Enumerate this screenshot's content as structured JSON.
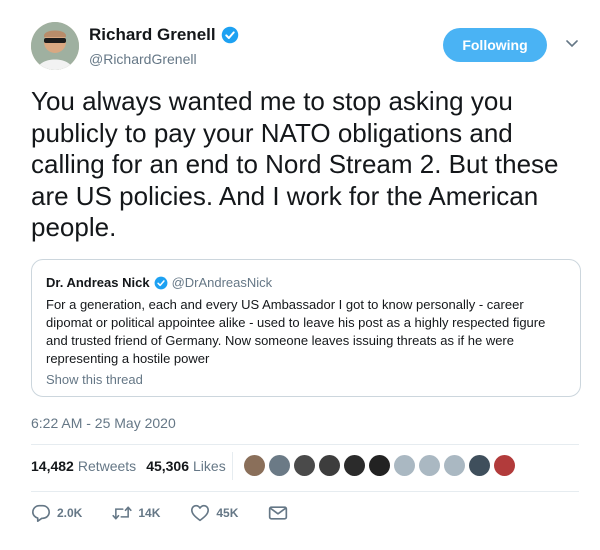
{
  "author": {
    "display_name": "Richard Grenell",
    "handle": "@RichardGrenell",
    "verified": true,
    "avatar_icon": "avatar"
  },
  "follow_button": {
    "label": "Following",
    "color": "#4ab3f4"
  },
  "more_menu_icon": "chevron-down-icon",
  "tweet": {
    "text": "You always wanted me to stop asking you publicly to pay your NATO obligations and calling for an end to Nord Stream 2. But these are US policies. And I work for the American people."
  },
  "quoted_tweet": {
    "display_name": "Dr. Andreas Nick",
    "handle": "@DrAndreasNick",
    "verified": true,
    "text": "For a generation, each and every US Ambassador I got to know personally - career dipomat or political appointee alike - used to leave his post as a highly respected figure and trusted friend of Germany. Now someone leaves issuing threats as if he were representing a hostile power",
    "show_thread": "Show this thread"
  },
  "timestamp": "6:22 AM - 25 May 2020",
  "stats": {
    "retweets_count": "14,482",
    "retweets_label": "Retweets",
    "likes_count": "45,306",
    "likes_label": "Likes"
  },
  "likers": [
    {
      "color": "#8a6f5a"
    },
    {
      "color": "#6b7a86"
    },
    {
      "color": "#4a4a4a"
    },
    {
      "color": "#3d3d3d"
    },
    {
      "color": "#2b2b2b"
    },
    {
      "color": "#222222"
    },
    {
      "color": "#aab8c2"
    },
    {
      "color": "#aab8c2"
    },
    {
      "color": "#aab8c2"
    },
    {
      "color": "#3f4f5c"
    },
    {
      "color": "#b23b3b"
    }
  ],
  "actions": {
    "reply_count": "2.0K",
    "retweet_count": "14K",
    "like_count": "45K"
  },
  "colors": {
    "verified": "#1da1f2",
    "secondary_text": "#657786",
    "border": "#ccd6dd"
  }
}
